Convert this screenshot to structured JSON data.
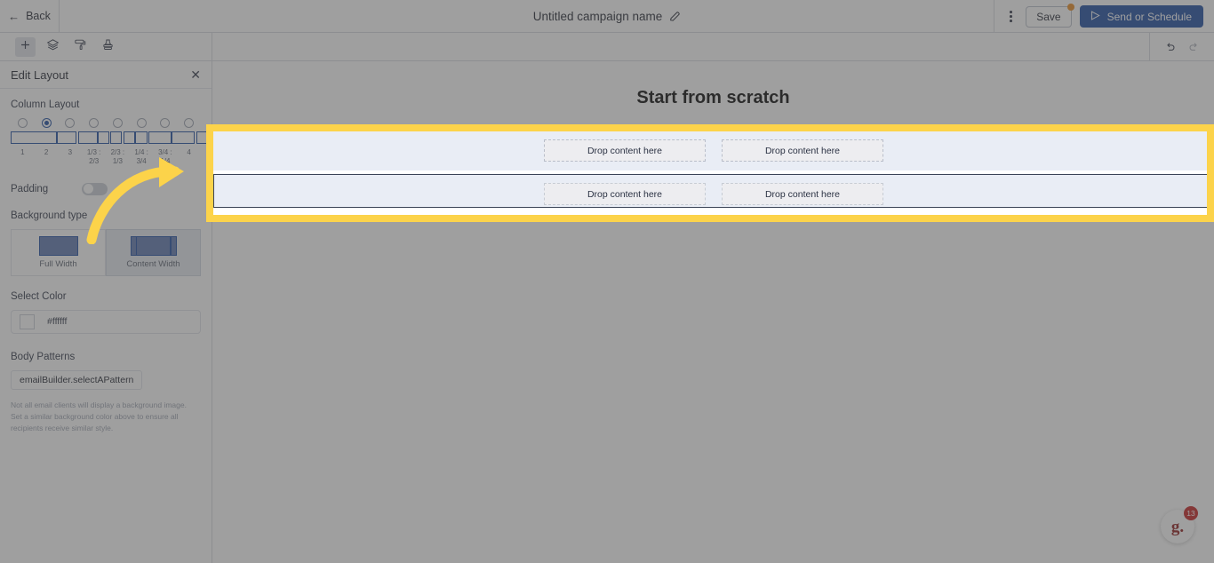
{
  "topbar": {
    "back_label": "Back",
    "back_icon": "arrow-left-icon",
    "campaign_title": "Untitled campaign name",
    "edit_icon": "pencil-icon",
    "overflow_icon": "kebab-menu-icon",
    "save_label": "Save",
    "save_badge": "unsaved-changes-dot",
    "send_label": "Send or Schedule",
    "send_icon": "send-plane-icon"
  },
  "toolbar": {
    "tools": [
      {
        "name": "add-block-button",
        "icon": "plus-icon",
        "active": true
      },
      {
        "name": "layers-button",
        "icon": "layers-icon",
        "active": false
      },
      {
        "name": "style-button",
        "icon": "paint-roller-icon",
        "active": false
      },
      {
        "name": "theme-button",
        "icon": "stamp-icon",
        "active": false
      }
    ],
    "undo_icon": "undo-icon",
    "redo_icon": "redo-icon"
  },
  "panel": {
    "title": "Edit Layout",
    "close_icon": "close-icon",
    "column_layout": {
      "label": "Column Layout",
      "selected_index": 1,
      "options": [
        {
          "label": "1",
          "widths": [
            52
          ]
        },
        {
          "label": "2",
          "widths": [
            22,
            22
          ]
        },
        {
          "label": "3",
          "widths": [
            13,
            13,
            13
          ]
        },
        {
          "label": "1/3 :\n2/3",
          "widths": [
            14,
            26
          ]
        },
        {
          "label": "2/3 :\n1/3",
          "widths": [
            26,
            14
          ]
        },
        {
          "label": "1/4 :\n3/4",
          "widths": [
            8,
            28
          ]
        },
        {
          "label": "3/4 :\n1/4",
          "widths": [
            28,
            8
          ]
        },
        {
          "label": "4",
          "widths": [
            8,
            8,
            8,
            8
          ]
        }
      ]
    },
    "padding": {
      "label": "Padding",
      "enabled": false
    },
    "background_type": {
      "label": "Background type",
      "selected": "Content Width",
      "options": [
        {
          "label": "Full Width",
          "icon": "full-width-icon"
        },
        {
          "label": "Content Width",
          "icon": "content-width-icon"
        }
      ]
    },
    "select_color": {
      "label": "Select Color",
      "value": "#ffffff",
      "swatch_color": "#ffffff"
    },
    "body_patterns": {
      "label": "Body Patterns",
      "button_label": "emailBuilder.selectAPattern",
      "helper_text": "Not all email clients will display a background image. Set a similar background color above to ensure all recipients receive similar style."
    }
  },
  "canvas": {
    "heading": "Start from scratch",
    "rows": [
      {
        "name": "row-1",
        "columns": [
          {
            "placeholder": "Drop content here"
          },
          {
            "placeholder": "Drop content here"
          }
        ],
        "selected": false
      },
      {
        "name": "row-2",
        "columns": [
          {
            "placeholder": "Drop content here"
          },
          {
            "placeholder": "Drop content here"
          }
        ],
        "selected": true
      }
    ]
  },
  "help_widget": {
    "logo_text": "g.",
    "badge_count": "13"
  },
  "annotation": {
    "highlight_color": "#fcd34a",
    "arrow_icon": "curved-arrow-icon"
  },
  "colors": {
    "accent": "#17479e",
    "highlight": "#fcd34a",
    "row_background": "#e9edf5",
    "badge_red": "#c41c1c",
    "save_dot": "#e8871a"
  }
}
